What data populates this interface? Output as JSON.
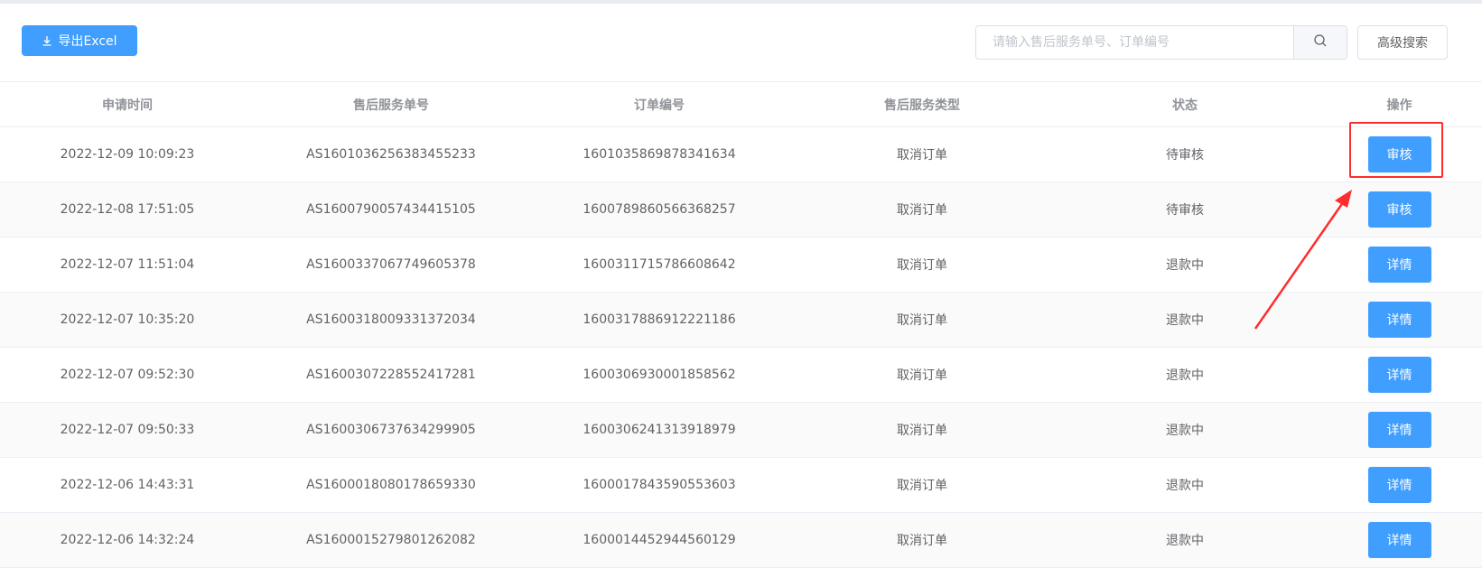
{
  "toolbar": {
    "export_label": "导出Excel",
    "export_icon": "download-icon",
    "search_placeholder": "请输入售后服务单号、订单编号",
    "search_value": "",
    "search_icon": "search-icon",
    "advanced_search_label": "高级搜索"
  },
  "table": {
    "columns": [
      "申请时间",
      "售后服务单号",
      "订单编号",
      "售后服务类型",
      "状态",
      "操作"
    ],
    "rows": [
      {
        "time": "2022-12-09 10:09:23",
        "service_no": "AS1601036256383455233",
        "order_no": "1601035869878341634",
        "type": "取消订单",
        "status": "待审核",
        "action": "审核"
      },
      {
        "time": "2022-12-08 17:51:05",
        "service_no": "AS1600790057434415105",
        "order_no": "1600789860566368257",
        "type": "取消订单",
        "status": "待审核",
        "action": "审核"
      },
      {
        "time": "2022-12-07 11:51:04",
        "service_no": "AS1600337067749605378",
        "order_no": "1600311715786608642",
        "type": "取消订单",
        "status": "退款中",
        "action": "详情"
      },
      {
        "time": "2022-12-07 10:35:20",
        "service_no": "AS1600318009331372034",
        "order_no": "1600317886912221186",
        "type": "取消订单",
        "status": "退款中",
        "action": "详情"
      },
      {
        "time": "2022-12-07 09:52:30",
        "service_no": "AS1600307228552417281",
        "order_no": "1600306930001858562",
        "type": "取消订单",
        "status": "退款中",
        "action": "详情"
      },
      {
        "time": "2022-12-07 09:50:33",
        "service_no": "AS1600306737634299905",
        "order_no": "1600306241313918979",
        "type": "取消订单",
        "status": "退款中",
        "action": "详情"
      },
      {
        "time": "2022-12-06 14:43:31",
        "service_no": "AS1600018080178659330",
        "order_no": "1600017843590553603",
        "type": "取消订单",
        "status": "退款中",
        "action": "详情"
      },
      {
        "time": "2022-12-06 14:32:24",
        "service_no": "AS1600015279801262082",
        "order_no": "1600014452944560129",
        "type": "取消订单",
        "status": "退款中",
        "action": "详情"
      }
    ]
  },
  "colors": {
    "primary": "#409eff",
    "annotation": "#ff2d2d"
  }
}
